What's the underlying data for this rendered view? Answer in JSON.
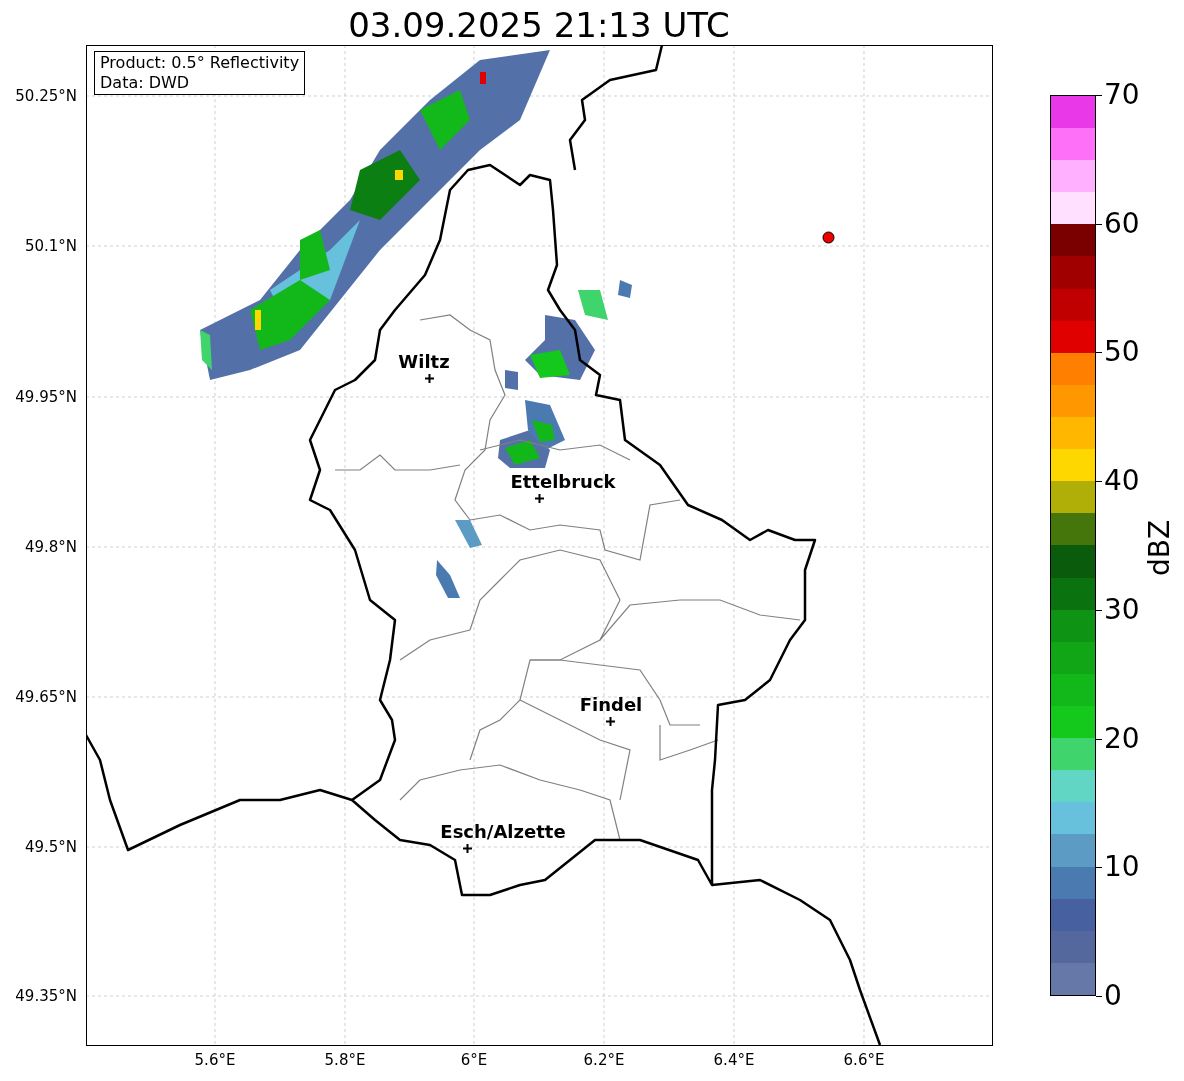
{
  "title": "03.09.2025 21:13 UTC",
  "info_box": [
    "Product: 0.5° Reflectivity",
    "Data: DWD"
  ],
  "lat_labels": [
    "50.25°N",
    "50.1°N",
    "49.95°N",
    "49.8°N",
    "49.65°N",
    "49.5°N",
    "49.35°N"
  ],
  "lon_labels": [
    "5.6°E",
    "5.8°E",
    "6°E",
    "6.2°E",
    "6.4°E",
    "6.6°E"
  ],
  "cities": [
    {
      "name": "Wiltz"
    },
    {
      "name": "Ettelbruck"
    },
    {
      "name": "Findel"
    },
    {
      "name": "Esch/Alzette"
    }
  ],
  "colorbar": {
    "label": "dBZ",
    "ticks": [
      "70",
      "60",
      "50",
      "40",
      "30",
      "20",
      "10",
      "0"
    ],
    "segments": [
      {
        "color": "#6678a8"
      },
      {
        "color": "#55689e"
      },
      {
        "color": "#4660a0"
      },
      {
        "color": "#4a7ab0"
      },
      {
        "color": "#5b9bc4"
      },
      {
        "color": "#67c0dc"
      },
      {
        "color": "#62d6c4"
      },
      {
        "color": "#3fd56c"
      },
      {
        "color": "#14c81c"
      },
      {
        "color": "#12b819"
      },
      {
        "color": "#10a616"
      },
      {
        "color": "#0f9314"
      },
      {
        "color": "#0b7210"
      },
      {
        "color": "#0a5c0c"
      },
      {
        "color": "#44760c"
      },
      {
        "color": "#afaf08"
      },
      {
        "color": "#ffd700"
      },
      {
        "color": "#ffb700"
      },
      {
        "color": "#ff9800"
      },
      {
        "color": "#ff7f00"
      },
      {
        "color": "#e00000"
      },
      {
        "color": "#c00000"
      },
      {
        "color": "#a00000"
      },
      {
        "color": "#7a0000"
      },
      {
        "color": "#ffe0ff"
      },
      {
        "color": "#ffb0ff"
      },
      {
        "color": "#ff70f8"
      },
      {
        "color": "#e838e8"
      }
    ]
  }
}
